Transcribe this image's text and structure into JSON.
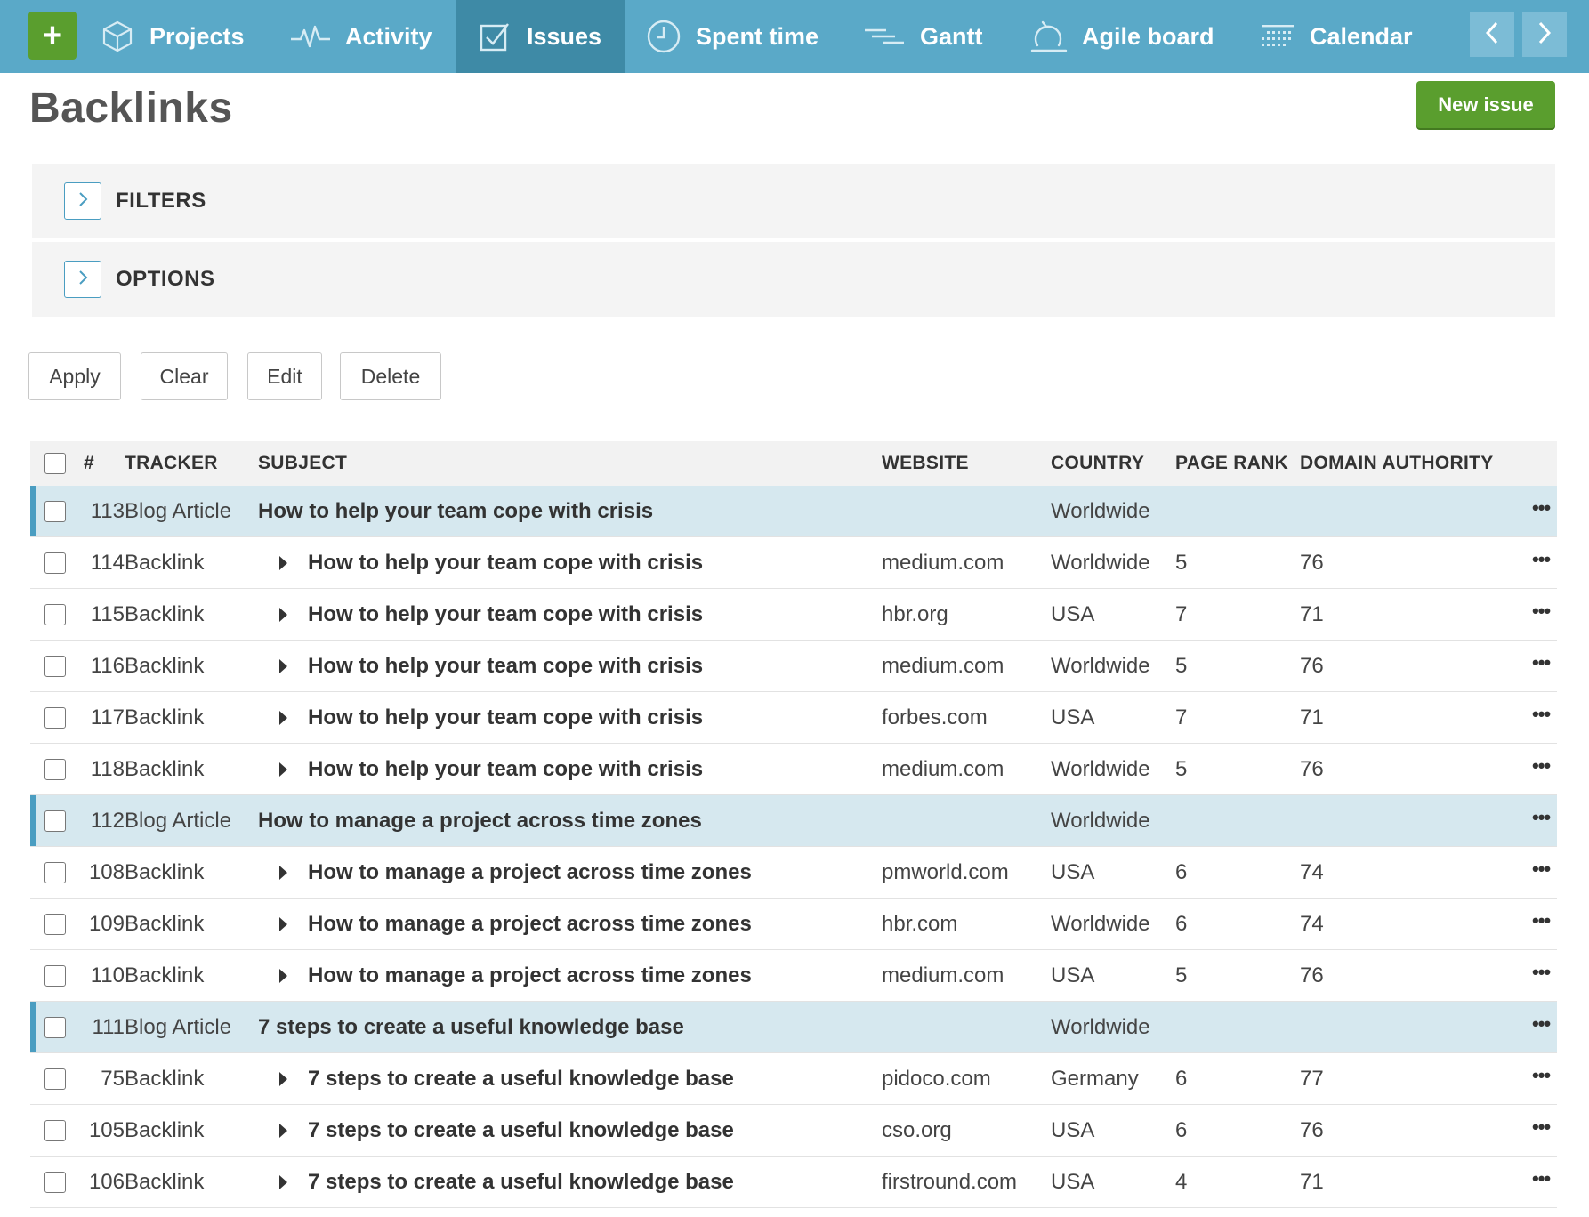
{
  "nav": {
    "plus_label": "+",
    "items": [
      {
        "label": "Projects",
        "icon": "cube-icon"
      },
      {
        "label": "Activity",
        "icon": "pulse-icon"
      },
      {
        "label": "Issues",
        "icon": "checkbox-icon",
        "active": true
      },
      {
        "label": "Spent time",
        "icon": "clock-icon"
      },
      {
        "label": "Gantt",
        "icon": "gantt-icon"
      },
      {
        "label": "Agile board",
        "icon": "agile-icon"
      },
      {
        "label": "Calendar",
        "icon": "calendar-icon"
      }
    ],
    "prev_icon": "chevron-left-icon",
    "next_icon": "chevron-right-icon",
    "accent": "#5aa9c8",
    "active_bg": "#3e8aa6"
  },
  "header": {
    "title": "Backlinks",
    "new_issue_label": "New issue"
  },
  "panels": {
    "filters": "FILTERS",
    "options": "OPTIONS"
  },
  "actions": {
    "apply": "Apply",
    "clear": "Clear",
    "edit": "Edit",
    "delete": "Delete"
  },
  "table": {
    "columns": {
      "id": "#",
      "tracker": "TRACKER",
      "subject": "SUBJECT",
      "website": "WEBSITE",
      "country": "COUNTRY",
      "page_rank": "PAGE RANK",
      "domain_authority": "DOMAIN AUTHORITY"
    },
    "more_label": "•••",
    "rows": [
      {
        "id": "113",
        "tracker": "Blog Article",
        "subject": "How to help your team cope with crisis",
        "website": "",
        "country": "Worldwide",
        "page_rank": "",
        "domain_authority": "",
        "parent": true
      },
      {
        "id": "114",
        "tracker": "Backlink",
        "subject": "How to help your team cope with crisis",
        "website": "medium.com",
        "country": "Worldwide",
        "page_rank": "5",
        "domain_authority": "76",
        "parent": false
      },
      {
        "id": "115",
        "tracker": "Backlink",
        "subject": "How to help your team cope with crisis",
        "website": "hbr.org",
        "country": "USA",
        "page_rank": "7",
        "domain_authority": "71",
        "parent": false
      },
      {
        "id": "116",
        "tracker": "Backlink",
        "subject": "How to help your team cope with crisis",
        "website": "medium.com",
        "country": "Worldwide",
        "page_rank": "5",
        "domain_authority": "76",
        "parent": false
      },
      {
        "id": "117",
        "tracker": "Backlink",
        "subject": "How to help your team cope with crisis",
        "website": "forbes.com",
        "country": "USA",
        "page_rank": "7",
        "domain_authority": "71",
        "parent": false
      },
      {
        "id": "118",
        "tracker": "Backlink",
        "subject": "How to help your team cope with crisis",
        "website": "medium.com",
        "country": "Worldwide",
        "page_rank": "5",
        "domain_authority": "76",
        "parent": false
      },
      {
        "id": "112",
        "tracker": "Blog Article",
        "subject": "How to manage a project across time zones",
        "website": "",
        "country": "Worldwide",
        "page_rank": "",
        "domain_authority": "",
        "parent": true
      },
      {
        "id": "108",
        "tracker": "Backlink",
        "subject": "How to manage a project across time zones",
        "website": "pmworld.com",
        "country": "USA",
        "page_rank": "6",
        "domain_authority": "74",
        "parent": false
      },
      {
        "id": "109",
        "tracker": "Backlink",
        "subject": "How to manage a project across time zones",
        "website": "hbr.com",
        "country": "Worldwide",
        "page_rank": "6",
        "domain_authority": "74",
        "parent": false
      },
      {
        "id": "110",
        "tracker": "Backlink",
        "subject": "How to manage a project across time zones",
        "website": "medium.com",
        "country": "USA",
        "page_rank": "5",
        "domain_authority": "76",
        "parent": false
      },
      {
        "id": "111",
        "tracker": "Blog Article",
        "subject": "7 steps to create a useful knowledge base",
        "website": "",
        "country": "Worldwide",
        "page_rank": "",
        "domain_authority": "",
        "parent": true
      },
      {
        "id": "75",
        "tracker": "Backlink",
        "subject": "7 steps to create a useful knowledge base",
        "website": "pidoco.com",
        "country": "Germany",
        "page_rank": "6",
        "domain_authority": "77",
        "parent": false
      },
      {
        "id": "105",
        "tracker": "Backlink",
        "subject": "7 steps to create a useful knowledge base",
        "website": "cso.org",
        "country": "USA",
        "page_rank": "6",
        "domain_authority": "76",
        "parent": false
      },
      {
        "id": "106",
        "tracker": "Backlink",
        "subject": "7 steps to create a useful knowledge base",
        "website": "firstround.com",
        "country": "USA",
        "page_rank": "4",
        "domain_authority": "71",
        "parent": false
      }
    ]
  }
}
